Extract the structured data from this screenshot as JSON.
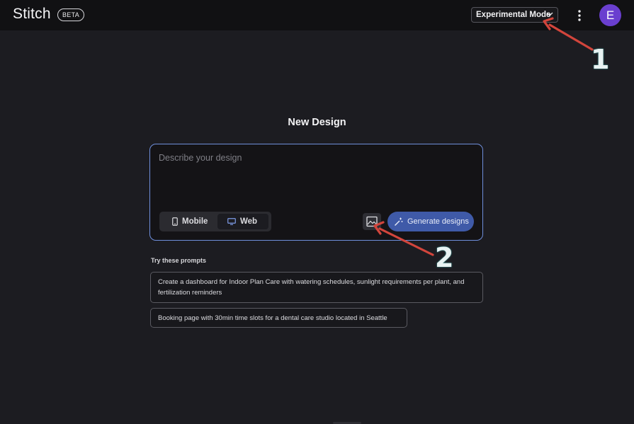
{
  "header": {
    "logo": "Stitch",
    "badge": "BETA",
    "mode_select": {
      "selected": "Experimental Mode"
    },
    "more_icon": "more-vertical-icon",
    "avatar_initial": "E",
    "avatar_color": "#6a3fcf"
  },
  "main": {
    "title": "New Design",
    "composer": {
      "placeholder": "Describe your design",
      "value": "",
      "device_options": [
        {
          "label": "Mobile",
          "icon": "phone-icon",
          "selected": false
        },
        {
          "label": "Web",
          "icon": "monitor-icon",
          "selected": true
        }
      ],
      "image_button_icon": "image-icon",
      "generate_label": "Generate designs",
      "generate_icon": "magic-wand-icon",
      "accent_color": "#3f5aa8"
    },
    "prompts": {
      "heading": "Try these prompts",
      "items": [
        "Create a dashboard for Indoor Plan Care with watering schedules, sunlight requirements per plant, and fertilization reminders",
        "Booking page with 30min time slots for a dental care studio located in Seattle"
      ]
    }
  },
  "annotations": {
    "labels": [
      "1",
      "2"
    ],
    "arrow_color": "#d2453c"
  }
}
